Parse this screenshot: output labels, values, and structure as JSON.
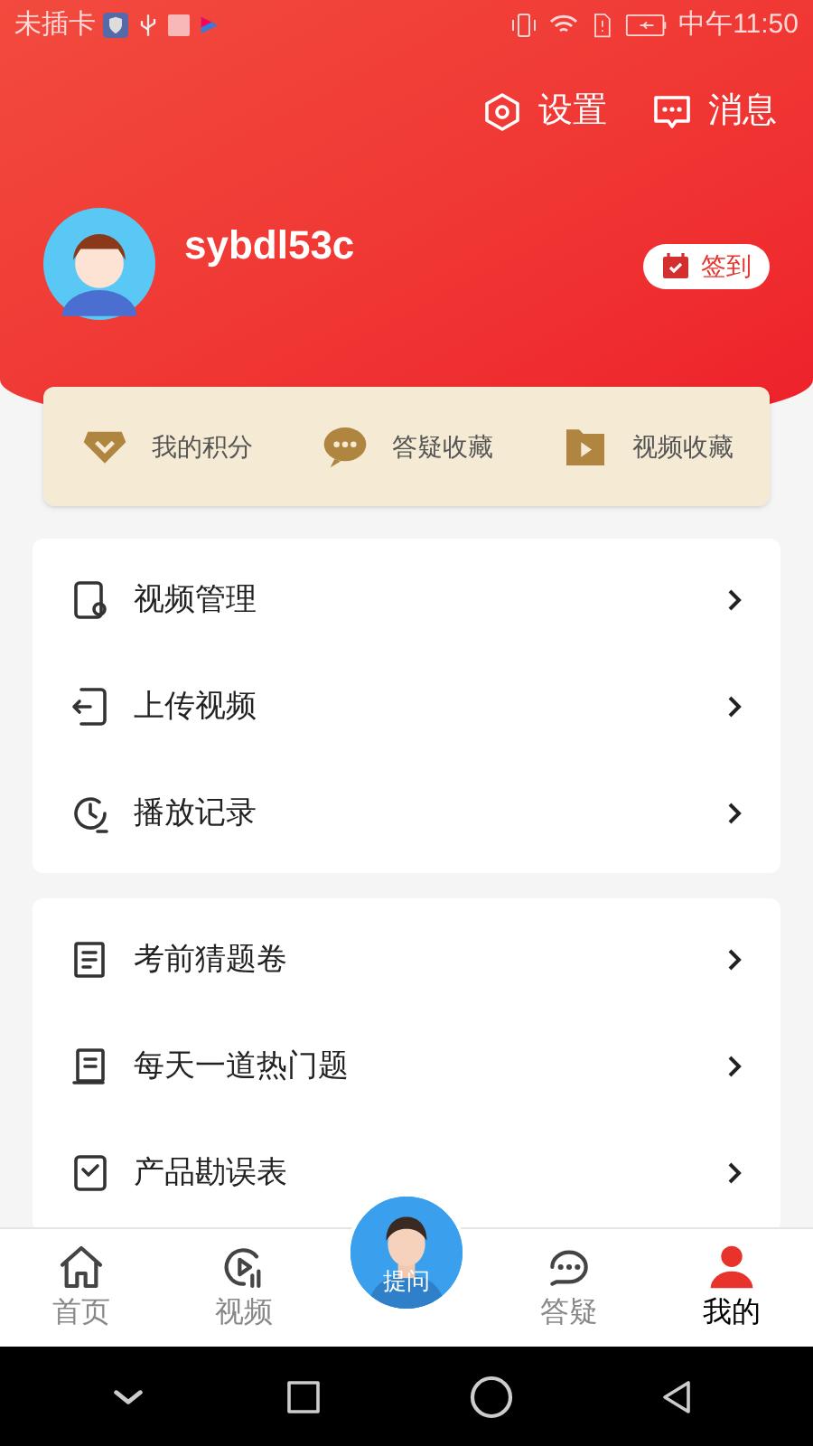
{
  "status_bar": {
    "carrier": "未插卡",
    "time": "中午11:50"
  },
  "header": {
    "actions": [
      {
        "kind": "settings",
        "label": "设置"
      },
      {
        "kind": "message",
        "label": "消息"
      }
    ],
    "username": "sybdl53c",
    "checkin": "签到"
  },
  "shortcuts": [
    {
      "kind": "points",
      "label": "我的积分"
    },
    {
      "kind": "qa",
      "label": "答疑收藏"
    },
    {
      "kind": "video",
      "label": "视频收藏"
    }
  ],
  "menu_groups": [
    [
      {
        "kind": "video-manage",
        "label": "视频管理"
      },
      {
        "kind": "upload",
        "label": "上传视频"
      },
      {
        "kind": "history",
        "label": "播放记录"
      }
    ],
    [
      {
        "kind": "paper",
        "label": "考前猜题卷"
      },
      {
        "kind": "daily",
        "label": "每天一道热门题"
      },
      {
        "kind": "errata",
        "label": "产品勘误表"
      }
    ]
  ],
  "tab_bar": [
    {
      "kind": "home",
      "label": "首页",
      "selected": false
    },
    {
      "kind": "video",
      "label": "视频",
      "selected": false
    },
    {
      "kind": "ask",
      "label": "提问",
      "selected": false
    },
    {
      "kind": "qa",
      "label": "答疑",
      "selected": false
    },
    {
      "kind": "me",
      "label": "我的",
      "selected": true
    }
  ]
}
